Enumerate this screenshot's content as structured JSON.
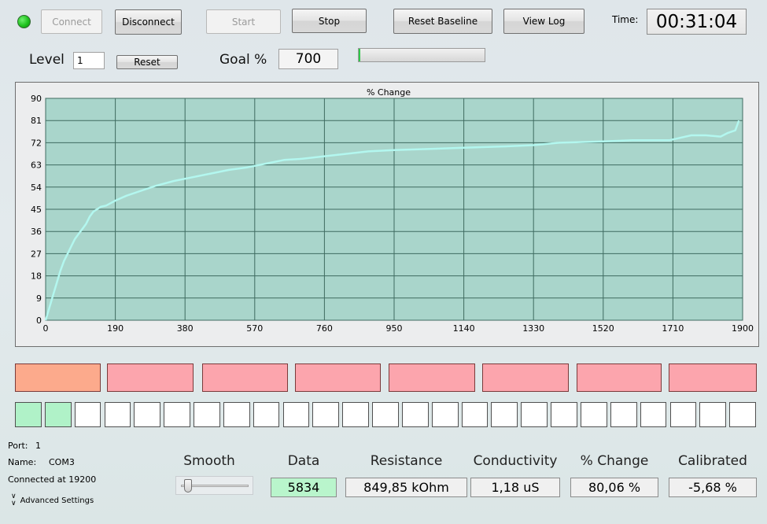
{
  "toolbar": {
    "connect_label": "Connect",
    "disconnect_label": "Disconnect",
    "start_label": "Start",
    "stop_label": "Stop",
    "reset_baseline_label": "Reset Baseline",
    "view_log_label": "View Log",
    "time_label": "Time:",
    "time_value": "00:31:04",
    "status_color": "#1fc21f"
  },
  "level": {
    "label": "Level",
    "value": "1",
    "reset_label": "Reset"
  },
  "goal": {
    "label": "Goal %",
    "value": "700",
    "progress_fraction": 0.01
  },
  "chart_data": {
    "type": "line",
    "title": "% Change",
    "xlabel": "",
    "ylabel": "",
    "xlim": [
      0,
      1900
    ],
    "ylim": [
      0,
      90
    ],
    "x_ticks": [
      0,
      190,
      380,
      570,
      760,
      950,
      1140,
      1330,
      1520,
      1710,
      1900
    ],
    "y_ticks": [
      0,
      9,
      18,
      27,
      36,
      45,
      54,
      63,
      72,
      81,
      90
    ],
    "grid": true,
    "line_color": "#b3f7ef",
    "plot_bg": "#a9d5cb",
    "series": [
      {
        "x": [
          0,
          10,
          20,
          30,
          40,
          50,
          60,
          70,
          80,
          90,
          100,
          110,
          120,
          130,
          140,
          150,
          165,
          190,
          220,
          260,
          300,
          350,
          400,
          450,
          500,
          550,
          600,
          650,
          700,
          760,
          820,
          880,
          950,
          1050,
          1140,
          1250,
          1330,
          1400,
          1520,
          1600,
          1700,
          1760,
          1800,
          1840,
          1860,
          1880,
          1890
        ],
        "y": [
          0,
          5,
          10,
          15,
          20,
          24,
          27,
          30,
          33,
          35,
          37,
          39,
          42,
          44,
          45,
          46,
          46.5,
          48.5,
          50.5,
          52.5,
          54.5,
          56.5,
          58,
          59.5,
          61,
          62,
          63.5,
          65,
          65.5,
          66.5,
          67.5,
          68.5,
          69,
          69.5,
          70,
          70.5,
          71,
          72,
          72.5,
          73,
          73,
          75,
          75,
          74.5,
          76,
          77,
          81
        ]
      }
    ]
  },
  "indicators": {
    "level_blocks": [
      {
        "color": "#fcaa8c"
      },
      {
        "color": "#fca5ad"
      },
      {
        "color": "#fca5ad"
      },
      {
        "color": "#fca5ad"
      },
      {
        "color": "#fca5ad"
      },
      {
        "color": "#fca5ad"
      },
      {
        "color": "#fca5ad"
      },
      {
        "color": "#fca5ad"
      }
    ],
    "squares_total": 25,
    "squares_lit": 2
  },
  "connection": {
    "port_label": "Port:",
    "port_value": "1",
    "name_label": "Name:",
    "name_value": "COM3",
    "status_text": "Connected at 19200",
    "advanced_label": "Advanced Settings"
  },
  "readouts": {
    "smooth_label": "Smooth",
    "smooth_fraction": 0.05,
    "data_label": "Data",
    "data_value": "5834",
    "resistance_label": "Resistance",
    "resistance_value": "849,85 kOhm",
    "conductivity_label": "Conductivity",
    "conductivity_value": "1,18 uS",
    "change_label": "% Change",
    "change_value": "80,06 %",
    "calibrated_label": "Calibrated",
    "calibrated_value": "-5,68 %"
  }
}
